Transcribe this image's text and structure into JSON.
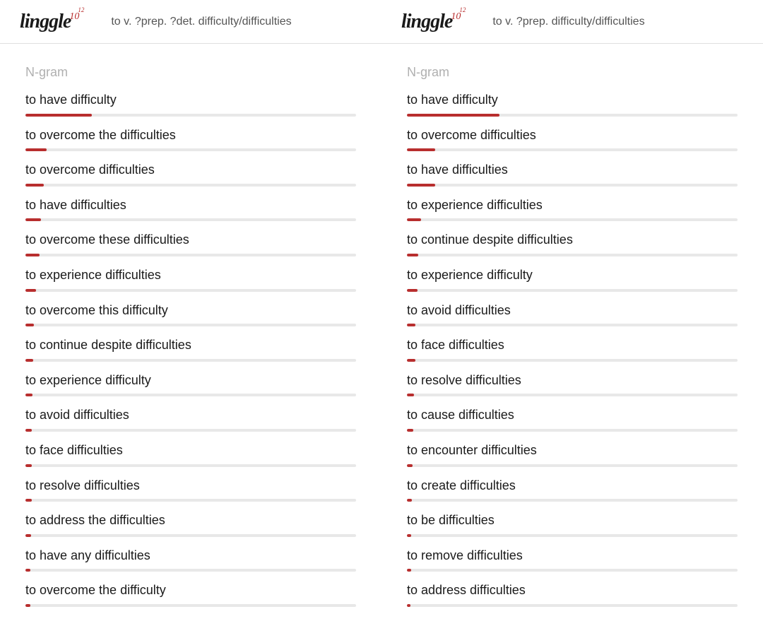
{
  "logo": {
    "text": "linggle",
    "exp_base": "10",
    "exp_sup": "12"
  },
  "left": {
    "search_value": "to v. ?prep. ?det. difficulty/difficulties",
    "section_title": "N-gram",
    "items": [
      {
        "text": "to have difficulty",
        "percent": 20
      },
      {
        "text": "to overcome the difficulties",
        "percent": 6.5
      },
      {
        "text": "to overcome difficulties",
        "percent": 5.5
      },
      {
        "text": "to have difficulties",
        "percent": 4.8
      },
      {
        "text": "to overcome these difficulties",
        "percent": 4.2
      },
      {
        "text": "to experience difficulties",
        "percent": 3.2
      },
      {
        "text": "to overcome this difficulty",
        "percent": 2.5
      },
      {
        "text": "to continue despite difficulties",
        "percent": 2.3
      },
      {
        "text": "to experience difficulty",
        "percent": 2.2
      },
      {
        "text": "to avoid difficulties",
        "percent": 2.0
      },
      {
        "text": "to face difficulties",
        "percent": 2.0
      },
      {
        "text": "to resolve difficulties",
        "percent": 2.0
      },
      {
        "text": "to address the difficulties",
        "percent": 1.8
      },
      {
        "text": "to have any difficulties",
        "percent": 1.6
      },
      {
        "text": "to overcome the difficulty",
        "percent": 1.4
      }
    ]
  },
  "right": {
    "search_value": "to v. ?prep. difficulty/difficulties",
    "section_title": "N-gram",
    "items": [
      {
        "text": "to have difficulty",
        "percent": 28
      },
      {
        "text": "to overcome difficulties",
        "percent": 8.5
      },
      {
        "text": "to have difficulties",
        "percent": 8.5
      },
      {
        "text": "to experience difficulties",
        "percent": 4.3
      },
      {
        "text": "to continue despite difficulties",
        "percent": 3.5
      },
      {
        "text": "to experience difficulty",
        "percent": 3.2
      },
      {
        "text": "to avoid difficulties",
        "percent": 2.5
      },
      {
        "text": "to face difficulties",
        "percent": 2.5
      },
      {
        "text": "to resolve difficulties",
        "percent": 2.2
      },
      {
        "text": "to cause difficulties",
        "percent": 2.0
      },
      {
        "text": "to encounter difficulties",
        "percent": 1.8
      },
      {
        "text": "to create difficulties",
        "percent": 1.5
      },
      {
        "text": "to be difficulties",
        "percent": 1.3
      },
      {
        "text": "to remove difficulties",
        "percent": 1.2
      },
      {
        "text": "to address difficulties",
        "percent": 1.1
      }
    ]
  }
}
